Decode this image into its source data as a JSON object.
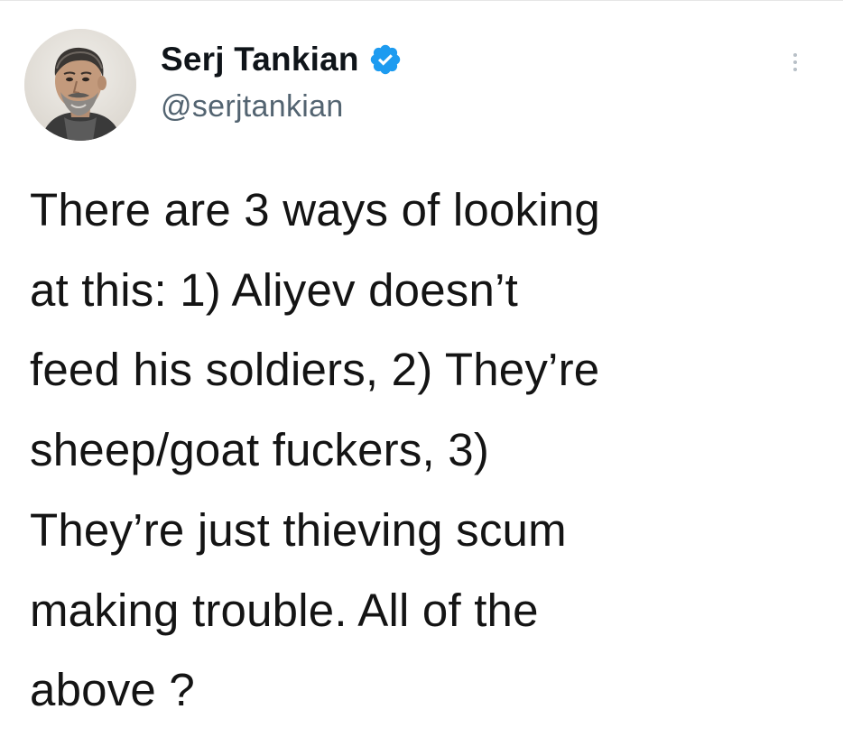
{
  "tweet": {
    "author": {
      "display_name": "Serj Tankian",
      "handle": "@serjtankian",
      "verified": true
    },
    "text": "There are 3 ways of looking\nat this: 1) Aliyev doesn’t\nfeed his soldiers, 2) They’re\nsheep/goat fuckers, 3)\nThey’re just thieving scum\nmaking trouble. All of the\nabove ?",
    "icons": {
      "verified": "verified-badge-icon",
      "more": "more-options-icon"
    },
    "colors": {
      "verified_blue": "#1d9bf0",
      "handle_gray": "#536471",
      "text": "#0f1419"
    }
  }
}
